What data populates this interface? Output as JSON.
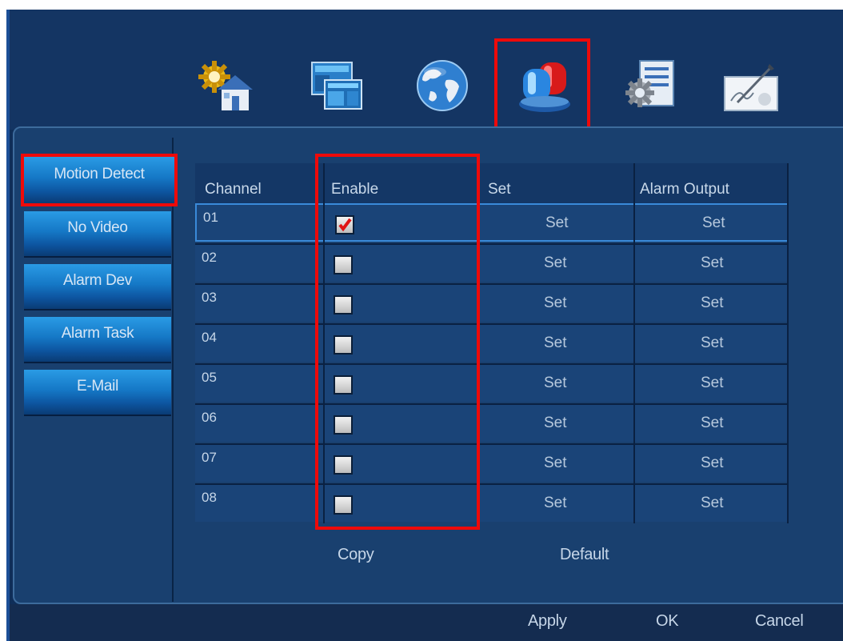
{
  "toolbar": {
    "icons": [
      {
        "name": "home-settings-icon"
      },
      {
        "name": "display-icon"
      },
      {
        "name": "globe-icon"
      },
      {
        "name": "alarm-siren-icon"
      },
      {
        "name": "system-gear-icon"
      },
      {
        "name": "signature-icon"
      }
    ],
    "selected_index": 3
  },
  "sidebar": {
    "items": [
      {
        "label": "Motion Detect",
        "active": true
      },
      {
        "label": "No Video"
      },
      {
        "label": "Alarm Dev"
      },
      {
        "label": "Alarm Task"
      },
      {
        "label": "E-Mail"
      }
    ]
  },
  "table": {
    "headers": [
      "Channel",
      "Enable",
      "Set",
      "Alarm Output"
    ],
    "rows": [
      {
        "channel": "01",
        "enabled": true,
        "set": "Set",
        "alarm_output": "Set"
      },
      {
        "channel": "02",
        "enabled": false,
        "set": "Set",
        "alarm_output": "Set"
      },
      {
        "channel": "03",
        "enabled": false,
        "set": "Set",
        "alarm_output": "Set"
      },
      {
        "channel": "04",
        "enabled": false,
        "set": "Set",
        "alarm_output": "Set"
      },
      {
        "channel": "05",
        "enabled": false,
        "set": "Set",
        "alarm_output": "Set"
      },
      {
        "channel": "06",
        "enabled": false,
        "set": "Set",
        "alarm_output": "Set"
      },
      {
        "channel": "07",
        "enabled": false,
        "set": "Set",
        "alarm_output": "Set"
      },
      {
        "channel": "08",
        "enabled": false,
        "set": "Set",
        "alarm_output": "Set"
      }
    ]
  },
  "actions": {
    "copy": "Copy",
    "default": "Default"
  },
  "footer": {
    "apply": "Apply",
    "ok": "OK",
    "cancel": "Cancel"
  },
  "colors": {
    "highlight": "#ee0a0a",
    "check": "#e01414"
  }
}
